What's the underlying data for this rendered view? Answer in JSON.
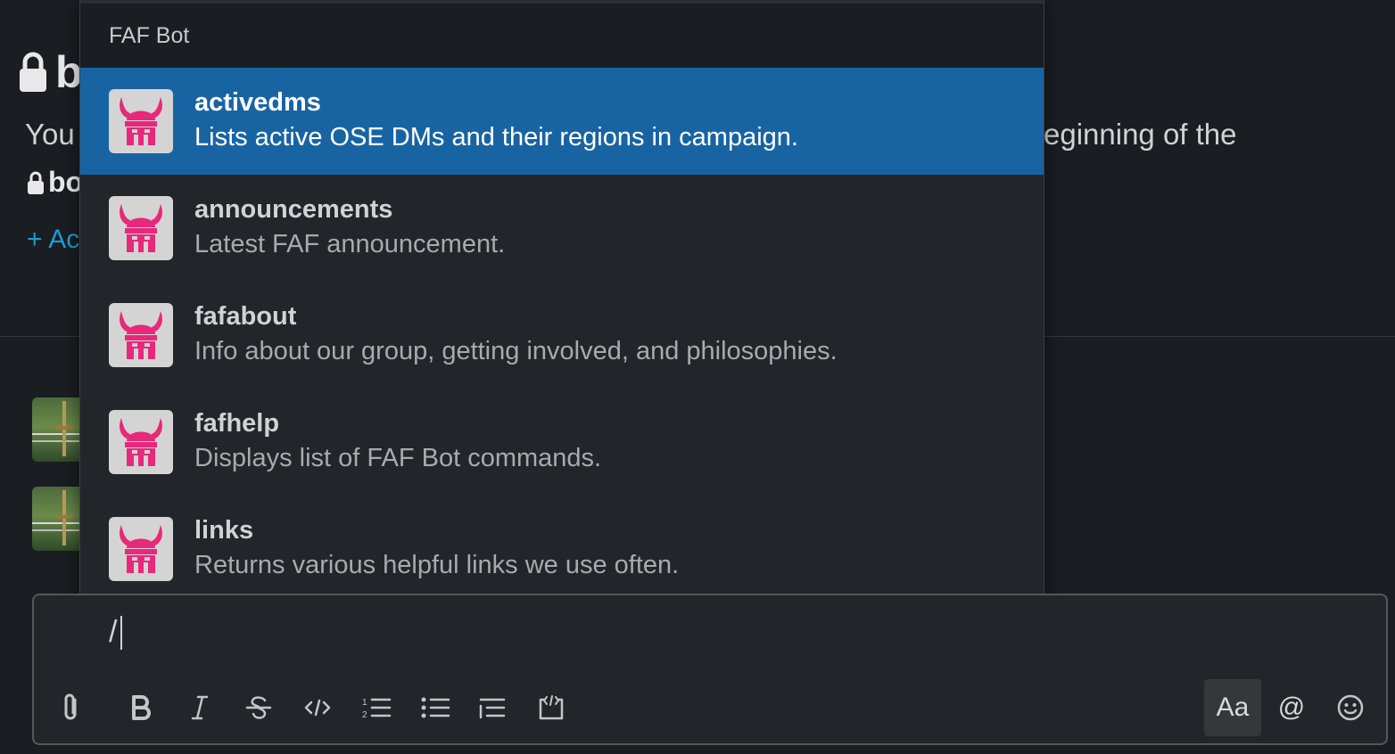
{
  "intro": {
    "title_initial": "b",
    "text_left": "You",
    "text_right": "eginning of the",
    "line2": "bo",
    "add_label": "+ Ac"
  },
  "popup": {
    "header": "FAF Bot",
    "commands": [
      {
        "name": "activedms",
        "description": "Lists active OSE DMs and their regions in campaign.",
        "selected": true
      },
      {
        "name": "announcements",
        "description": "Latest FAF announcement.",
        "selected": false
      },
      {
        "name": "fafabout",
        "description": "Info about our group, getting involved, and philosophies.",
        "selected": false
      },
      {
        "name": "fafhelp",
        "description": "Displays list of FAF Bot commands.",
        "selected": false
      },
      {
        "name": "links",
        "description": "Returns various helpful links we use often.",
        "selected": false
      }
    ],
    "icon": "viking-helmet-icon",
    "icon_color": "#e8287a",
    "selected_color": "#1864a3"
  },
  "composer": {
    "value": "/",
    "format_label": "Aa",
    "at_label": "@"
  }
}
